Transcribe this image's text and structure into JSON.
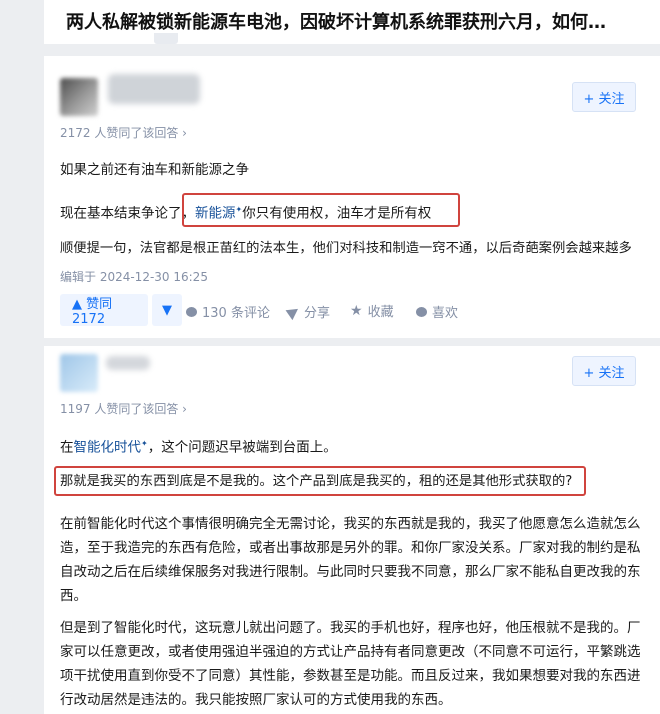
{
  "question": {
    "title": "两人私解被锁新能源车电池，因破坏计算机系统罪获刑六月，如何…"
  },
  "answers": [
    {
      "follow_label": "+ 关注",
      "upvote_meta": "2172 人赞同了该回答 ›",
      "para1": "如果之前还有油车和新能源之争",
      "para2_prefix": "现在基本结束争论了，",
      "para2_link": "新能源",
      "para2_highlight": "你只有使用权，油车才是所有权",
      "para3": "顺便提一句，法官都是根正苗红的法本生，他们对科技和制造一窍不通，以后奇葩案例会越来越多",
      "edited": "编辑于 2024-12-30 16:25",
      "vote_label": "▲ 赞同 2172",
      "vote_down": "▼",
      "comments": "130 条评论",
      "share": "分享",
      "collect": "收藏",
      "like": "喜欢"
    },
    {
      "follow_label": "+ 关注",
      "upvote_meta": "1197 人赞同了该回答 ›",
      "para1_prefix": "在",
      "para1_link": "智能化时代",
      "para1_suffix": "，这个问题迟早被端到台面上。",
      "highlight": "那就是我买的东西到底是不是我的。这个产品到底是我买的，租的还是其他形式获取的?",
      "para3": "在前智能化时代这个事情很明确完全无需讨论，我买的东西就是我的，我买了他愿意怎么造就怎么造，至于我造完的东西有危险，或者出事故那是另外的罪。和你厂家没关系。厂家对我的制约是私自改动之后在后续维保服务对我进行限制。与此同时只要我不同意，那么厂家不能私自更改我的东西。",
      "para4": "但是到了智能化时代，这玩意儿就出问题了。我买的手机也好，程序也好，他压根就不是我的。厂家可以任意更改，或者使用强迫半强迫的方式让产品持有者同意更改（不同意不可运行，平繁跳选项干扰使用直到你受不了同意）其性能，参数甚至是功能。而且反过来，我如果想要对我的东西进行改动居然是违法的。我只能按照厂家认可的方式使用我的东西。"
    }
  ],
  "colors": {
    "accent": "#1772f6",
    "highlight_border": "#d0443e",
    "meta": "#8590a6",
    "link": "#175199"
  }
}
